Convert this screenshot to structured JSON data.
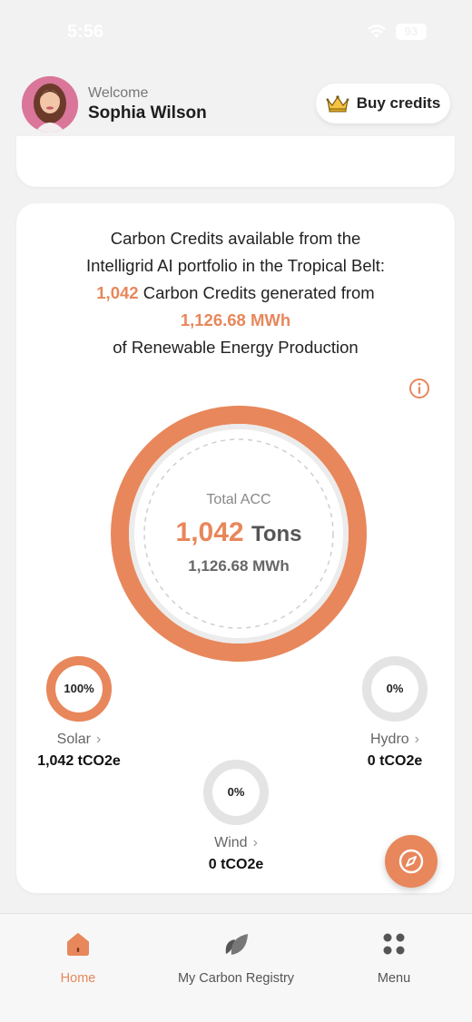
{
  "status_bar": {
    "time": "5:56",
    "battery": "93"
  },
  "header": {
    "welcome": "Welcome",
    "user_name": "Sophia Wilson",
    "buy_credits_label": "Buy credits"
  },
  "summary": {
    "line1": "Carbon Credits available from the",
    "line2": "Intelligrid AI portfolio in the Tropical Belt:",
    "credits_value": "1,042",
    "credits_text": "Carbon Credits generated from",
    "energy_value": "1,126.68 MWh",
    "line5": "of Renewable Energy Production"
  },
  "total": {
    "label": "Total ACC",
    "tons_value": "1,042",
    "tons_unit": "Tons",
    "mwh": "1,126.68 MWh"
  },
  "sources": [
    {
      "name": "Solar",
      "percent": "100%",
      "fraction": 1.0,
      "value": "1,042 tCO2e"
    },
    {
      "name": "Hydro",
      "percent": "0%",
      "fraction": 0.0,
      "value": "0 tCO2e"
    },
    {
      "name": "Wind",
      "percent": "0%",
      "fraction": 0.0,
      "value": "0 tCO2e"
    }
  ],
  "bottom_nav": {
    "items": [
      {
        "label": "Home",
        "icon": "home-icon",
        "active": true
      },
      {
        "label": "My Carbon Registry",
        "icon": "leaf-icon",
        "active": false
      },
      {
        "label": "Menu",
        "icon": "menu-dots-icon",
        "active": false
      }
    ]
  },
  "colors": {
    "accent": "#e8875b",
    "ring_inactive": "#e4e4e4",
    "background": "#f2f2f2"
  }
}
